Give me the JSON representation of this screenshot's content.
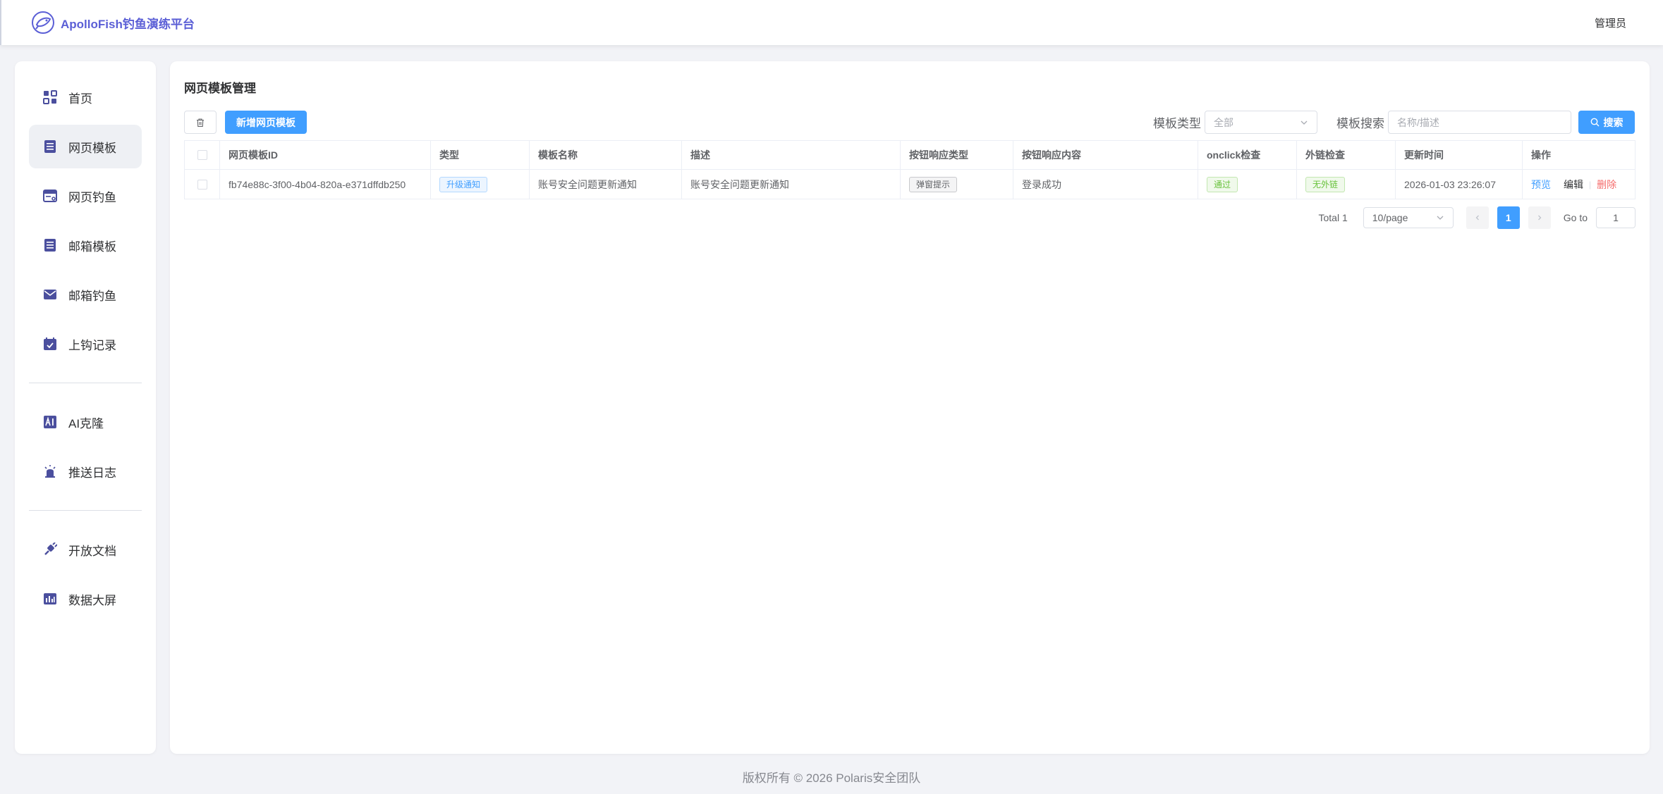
{
  "header": {
    "brand_title": "ApolloFish钓鱼演练平台",
    "user_label": "管理员"
  },
  "sidebar": {
    "items": [
      {
        "label": "首页",
        "icon": "dashboard-icon"
      },
      {
        "label": "网页模板",
        "icon": "document-list-icon"
      },
      {
        "label": "网页钓鱼",
        "icon": "browser-window-icon"
      },
      {
        "label": "邮箱模板",
        "icon": "document-list-icon"
      },
      {
        "label": "邮箱钓鱼",
        "icon": "envelope-icon"
      },
      {
        "label": "上钩记录",
        "icon": "calendar-check-icon"
      },
      {
        "label": "AI克隆",
        "icon": "ai-icon"
      },
      {
        "label": "推送日志",
        "icon": "alarm-bell-icon"
      },
      {
        "label": "开放文档",
        "icon": "plug-icon"
      },
      {
        "label": "数据大屏",
        "icon": "bar-chart-icon"
      }
    ],
    "active_index": 1
  },
  "main": {
    "title": "网页模板管理",
    "new_button": "新增网页模板",
    "filter_type_label": "模板类型",
    "filter_type_value": "全部",
    "search_label": "模板搜索",
    "search_placeholder": "名称/描述",
    "search_button": "搜索"
  },
  "table": {
    "columns": [
      "网页模板ID",
      "类型",
      "模板名称",
      "描述",
      "按钮响应类型",
      "按钮响应内容",
      "onclick检查",
      "外链检查",
      "更新时间",
      "操作"
    ],
    "rows": [
      {
        "id": "fb74e88c-3f00-4b04-820a-e371dffdb250",
        "type": "升级通知",
        "name": "账号安全问题更新通知",
        "description": "账号安全问题更新通知",
        "response_type": "弹窗提示",
        "response_content": "登录成功",
        "onclick_check": "通过",
        "link_check": "无外链",
        "updated_at": "2026-01-03 23:26:07",
        "actions": {
          "preview": "预览",
          "edit": "编辑",
          "delete": "删除"
        }
      }
    ]
  },
  "pagination": {
    "total_label": "Total 1",
    "page_size": "10/page",
    "current_page": "1",
    "goto_label": "Go to",
    "goto_value": "1"
  },
  "footer": {
    "text": "版权所有 © 2026 Polaris安全团队"
  },
  "colors": {
    "primary": "#409eff",
    "brand": "#5b5fd6",
    "icon": "#4b4f9e",
    "success": "#67c23a",
    "danger": "#f56c6c"
  }
}
